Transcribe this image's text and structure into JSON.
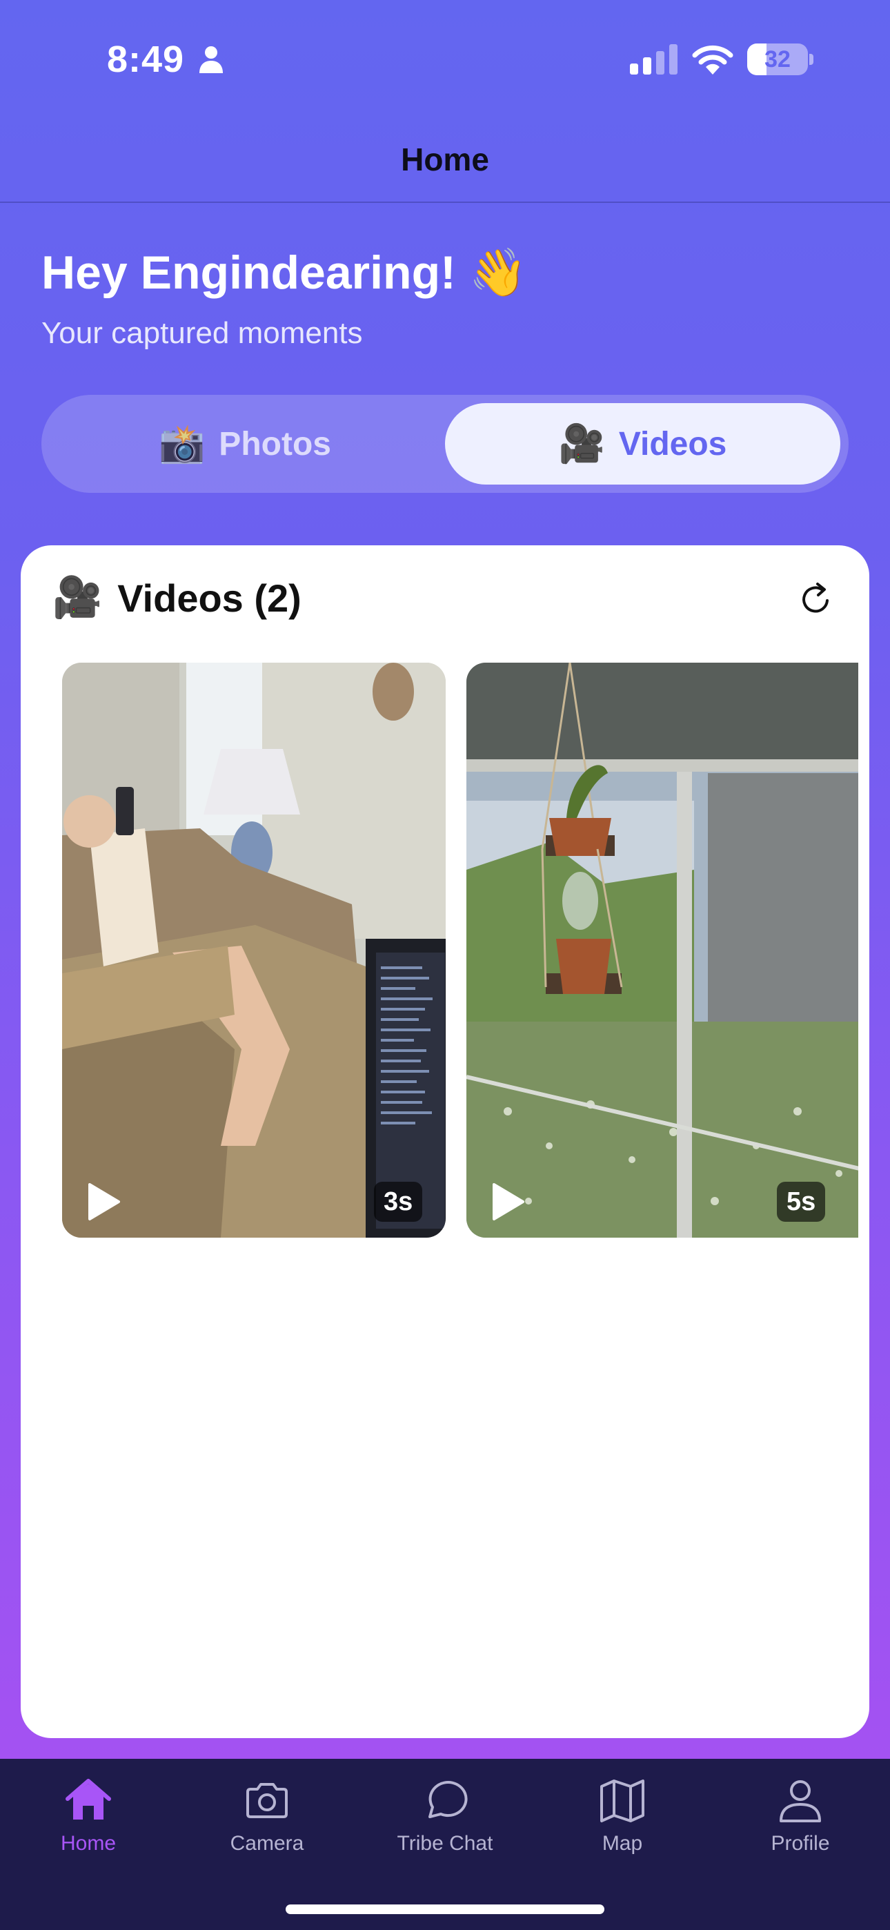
{
  "status_bar": {
    "time": "8:49",
    "battery": "32",
    "battery_level": 0.32,
    "icons": [
      "person-icon",
      "cellular-signal-icon",
      "wifi-icon",
      "battery-icon"
    ]
  },
  "header": {
    "title": "Home"
  },
  "greeting": {
    "title": "Hey Engindearing! 👋",
    "subtitle": "Your captured moments"
  },
  "segments": [
    {
      "emoji": "📸",
      "label": "Photos",
      "selected": false
    },
    {
      "emoji": "🎥",
      "label": "Videos",
      "selected": true
    }
  ],
  "videos_card": {
    "emoji": "🎥",
    "title": "Videos (2)",
    "refresh_icon": "refresh-icon",
    "items": [
      {
        "duration": "3s",
        "icon": "play-icon"
      },
      {
        "duration": "5s",
        "icon": "play-icon"
      }
    ]
  },
  "tab_bar": {
    "active_color": "#a855f7",
    "items": [
      {
        "label": "Home",
        "icon": "home-icon",
        "active": true
      },
      {
        "label": "Camera",
        "icon": "camera-icon",
        "active": false
      },
      {
        "label": "Tribe Chat",
        "icon": "chat-bubble-icon",
        "active": false
      },
      {
        "label": "Map",
        "icon": "map-icon",
        "active": false
      },
      {
        "label": "Profile",
        "icon": "person-icon",
        "active": false
      }
    ]
  },
  "colors": {
    "primary": "#6366f0",
    "gradient_end": "#a855f7",
    "tab_bar_bg": "#1e1b4b"
  }
}
